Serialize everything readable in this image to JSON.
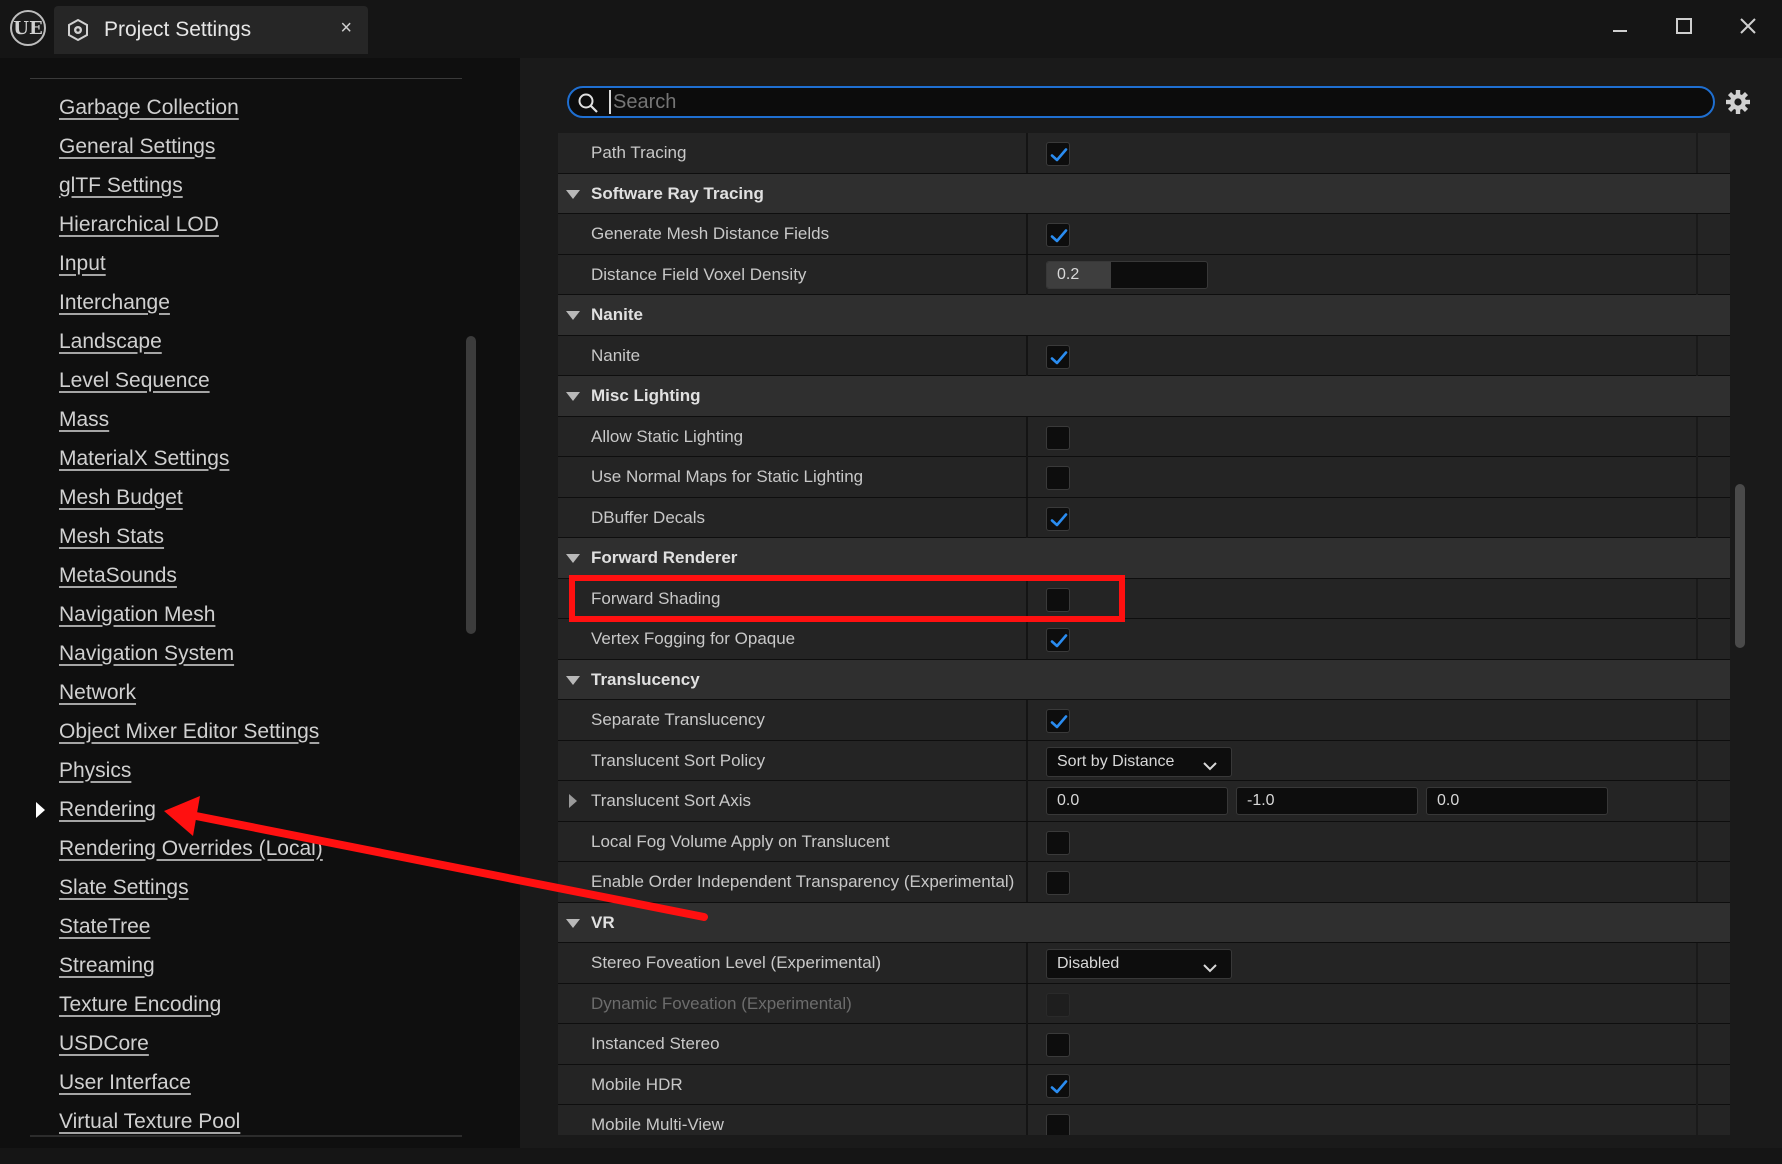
{
  "window": {
    "logo": "UE",
    "tab_title": "Project Settings",
    "tab_close": "×",
    "icons": {
      "logo": "unreal-logo-icon",
      "tab": "settings-cube-icon",
      "minimize": "minimize-icon",
      "maximize": "maximize-icon",
      "close": "close-icon"
    }
  },
  "sidebar": {
    "items": [
      {
        "label": "Garbage Collection"
      },
      {
        "label": "General Settings"
      },
      {
        "label": "glTF Settings"
      },
      {
        "label": "Hierarchical LOD"
      },
      {
        "label": "Input"
      },
      {
        "label": "Interchange"
      },
      {
        "label": "Landscape"
      },
      {
        "label": "Level Sequence"
      },
      {
        "label": "Mass"
      },
      {
        "label": "MaterialX Settings"
      },
      {
        "label": "Mesh Budget"
      },
      {
        "label": "Mesh Stats"
      },
      {
        "label": "MetaSounds"
      },
      {
        "label": "Navigation Mesh"
      },
      {
        "label": "Navigation System"
      },
      {
        "label": "Network"
      },
      {
        "label": "Object Mixer Editor Settings"
      },
      {
        "label": "Physics"
      },
      {
        "label": "Rendering",
        "selected": true
      },
      {
        "label": "Rendering Overrides (Local)"
      },
      {
        "label": "Slate Settings"
      },
      {
        "label": "StateTree"
      },
      {
        "label": "Streaming"
      },
      {
        "label": "Texture Encoding"
      },
      {
        "label": "USDCore"
      },
      {
        "label": "User Interface"
      },
      {
        "label": "Virtual Texture Pool"
      }
    ]
  },
  "search": {
    "placeholder": "Search",
    "value": ""
  },
  "properties": [
    {
      "kind": "prop",
      "name": "Path Tracing",
      "type": "checkbox",
      "checked": true
    },
    {
      "kind": "category",
      "name": "Software Ray Tracing"
    },
    {
      "kind": "prop",
      "name": "Generate Mesh Distance Fields",
      "type": "checkbox",
      "checked": true
    },
    {
      "kind": "prop",
      "name": "Distance Field Voxel Density",
      "type": "number",
      "value": "0.2",
      "fill_fraction": 0.4
    },
    {
      "kind": "category",
      "name": "Nanite"
    },
    {
      "kind": "prop",
      "name": "Nanite",
      "type": "checkbox",
      "checked": true
    },
    {
      "kind": "category",
      "name": "Misc Lighting"
    },
    {
      "kind": "prop",
      "name": "Allow Static Lighting",
      "type": "checkbox",
      "checked": false
    },
    {
      "kind": "prop",
      "name": "Use Normal Maps for Static Lighting",
      "type": "checkbox",
      "checked": false
    },
    {
      "kind": "prop",
      "name": "DBuffer Decals",
      "type": "checkbox",
      "checked": true
    },
    {
      "kind": "category",
      "name": "Forward Renderer"
    },
    {
      "kind": "prop",
      "name": "Forward Shading",
      "type": "checkbox",
      "checked": false,
      "highlighted": true
    },
    {
      "kind": "prop",
      "name": "Vertex Fogging for Opaque",
      "type": "checkbox",
      "checked": true
    },
    {
      "kind": "category",
      "name": "Translucency"
    },
    {
      "kind": "prop",
      "name": "Separate Translucency",
      "type": "checkbox",
      "checked": true
    },
    {
      "kind": "prop",
      "name": "Translucent Sort Policy",
      "type": "dropdown",
      "value": "Sort by Distance"
    },
    {
      "kind": "prop",
      "name": "Translucent Sort Axis",
      "type": "vector3",
      "values": [
        "0.0",
        "-1.0",
        "0.0"
      ],
      "expandable": true
    },
    {
      "kind": "prop",
      "name": "Local Fog Volume Apply on Translucent",
      "type": "checkbox",
      "checked": false
    },
    {
      "kind": "prop",
      "name": "Enable Order Independent Transparency (Experimental)",
      "type": "checkbox",
      "checked": false
    },
    {
      "kind": "category",
      "name": "VR"
    },
    {
      "kind": "prop",
      "name": "Stereo Foveation Level (Experimental)",
      "type": "dropdown",
      "value": "Disabled"
    },
    {
      "kind": "prop",
      "name": "Dynamic Foveation (Experimental)",
      "type": "checkbox",
      "checked": false,
      "disabled": true
    },
    {
      "kind": "prop",
      "name": "Instanced Stereo",
      "type": "checkbox",
      "checked": false
    },
    {
      "kind": "prop",
      "name": "Mobile HDR",
      "type": "checkbox",
      "checked": true
    },
    {
      "kind": "prop",
      "name": "Mobile Multi-View",
      "type": "checkbox",
      "checked": false
    }
  ],
  "colors": {
    "accent": "#1f6fd1",
    "check": "#2a8cf0",
    "annotation": "#ff1010"
  }
}
